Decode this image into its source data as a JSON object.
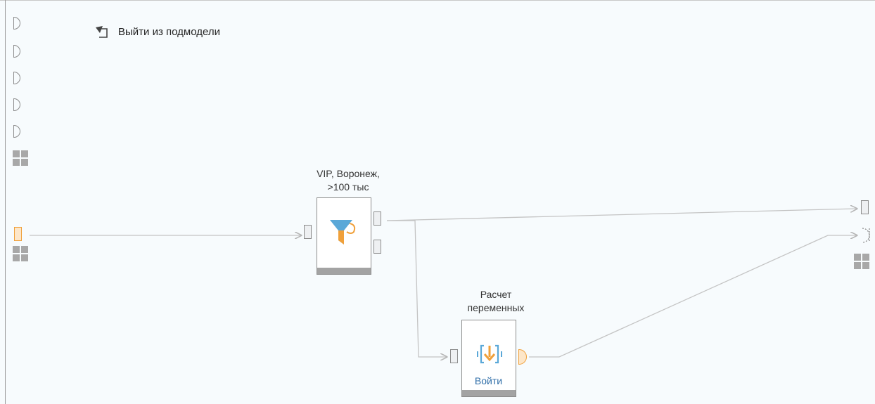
{
  "toolbar": {
    "exit_label": "Выйти из подмодели"
  },
  "nodes": {
    "filter": {
      "title_line1": "VIP, Воронеж,",
      "title_line2": ">100 тыс"
    },
    "calc": {
      "title_line1": "Расчет",
      "title_line2": "переменных",
      "enter_label": "Войти"
    }
  },
  "colors": {
    "background": "#f7fbfd",
    "port_border": "#8c8c8c",
    "orange_accent": "#f0a03a",
    "blue_accent": "#2f6ea8",
    "link_line": "#c4c4c4"
  }
}
